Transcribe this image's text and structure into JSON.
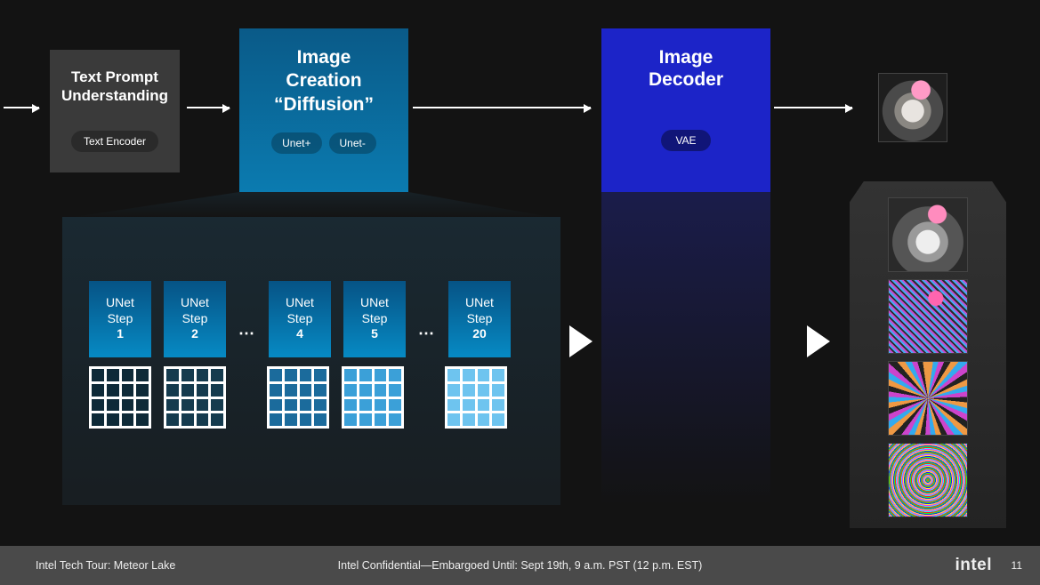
{
  "stage1": {
    "title_l1": "Text Prompt",
    "title_l2": "Understanding",
    "pill": "Text Encoder"
  },
  "stage2": {
    "title_l1": "Image",
    "title_l2": "Creation",
    "title_l3": "“Diffusion”",
    "pill_a": "Unet+",
    "pill_b": "Unet-"
  },
  "stage3": {
    "title_l1": "Image",
    "title_l2": "Decoder",
    "pill": "VAE"
  },
  "unet": {
    "label": "UNet",
    "step_word": "Step",
    "steps": [
      "1",
      "2",
      "4",
      "5",
      "20"
    ],
    "dots": "⋯",
    "grid_colors": [
      "#0e2a38",
      "#153b4e",
      "#1b6b9c",
      "#3ba0d8",
      "#6ec4ef"
    ]
  },
  "footer": {
    "left": "Intel Tech Tour: Meteor Lake",
    "center": "Intel Confidential—Embargoed Until: Sept 19th, 9 a.m. PST (12 p.m. EST)",
    "logo": "intel",
    "page": "11"
  }
}
